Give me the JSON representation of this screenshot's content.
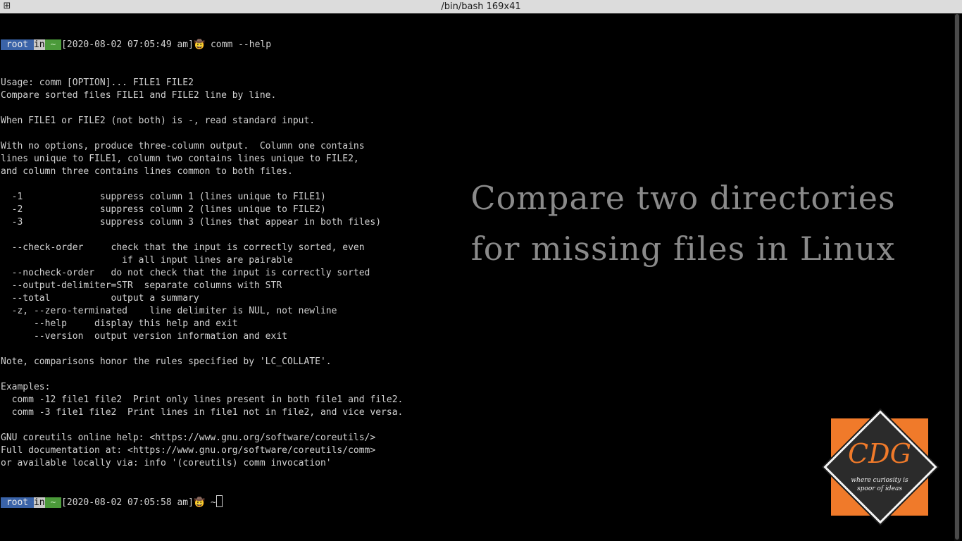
{
  "window": {
    "title": "/bin/bash 169x41",
    "menu_icon": "window-menu-icon"
  },
  "prompt1": {
    "user": " root ",
    "in": "in",
    "dir": " ~ ",
    "timestamp": "[2020-08-02 07:05:49 am]",
    "emoji": "🤠",
    "command": " comm --help"
  },
  "output": [
    "Usage: comm [OPTION]... FILE1 FILE2",
    "Compare sorted files FILE1 and FILE2 line by line.",
    "",
    "When FILE1 or FILE2 (not both) is -, read standard input.",
    "",
    "With no options, produce three-column output.  Column one contains",
    "lines unique to FILE1, column two contains lines unique to FILE2,",
    "and column three contains lines common to both files.",
    "",
    "  -1              suppress column 1 (lines unique to FILE1)",
    "  -2              suppress column 2 (lines unique to FILE2)",
    "  -3              suppress column 3 (lines that appear in both files)",
    "",
    "  --check-order     check that the input is correctly sorted, even",
    "                      if all input lines are pairable",
    "  --nocheck-order   do not check that the input is correctly sorted",
    "  --output-delimiter=STR  separate columns with STR",
    "  --total           output a summary",
    "  -z, --zero-terminated    line delimiter is NUL, not newline",
    "      --help     display this help and exit",
    "      --version  output version information and exit",
    "",
    "Note, comparisons honor the rules specified by 'LC_COLLATE'.",
    "",
    "Examples:",
    "  comm -12 file1 file2  Print only lines present in both file1 and file2.",
    "  comm -3 file1 file2  Print lines in file1 not in file2, and vice versa.",
    "",
    "GNU coreutils online help: <https://www.gnu.org/software/coreutils/>",
    "Full documentation at: <https://www.gnu.org/software/coreutils/comm>",
    "or available locally via: info '(coreutils) comm invocation'"
  ],
  "prompt2": {
    "user": " root ",
    "in": "in",
    "dir": " ~ ",
    "timestamp": "[2020-08-02 07:05:58 am]",
    "emoji": "🤠",
    "command": " ~"
  },
  "overlay": {
    "line1": "Compare two directories",
    "line2": "for missing files in Linux"
  },
  "logo": {
    "brand": "CDG",
    "tagline_1": "where curiosity is",
    "tagline_2": "spoor of ideas",
    "colors": {
      "accent": "#f07a2a",
      "dark": "#2b2b2b"
    }
  }
}
